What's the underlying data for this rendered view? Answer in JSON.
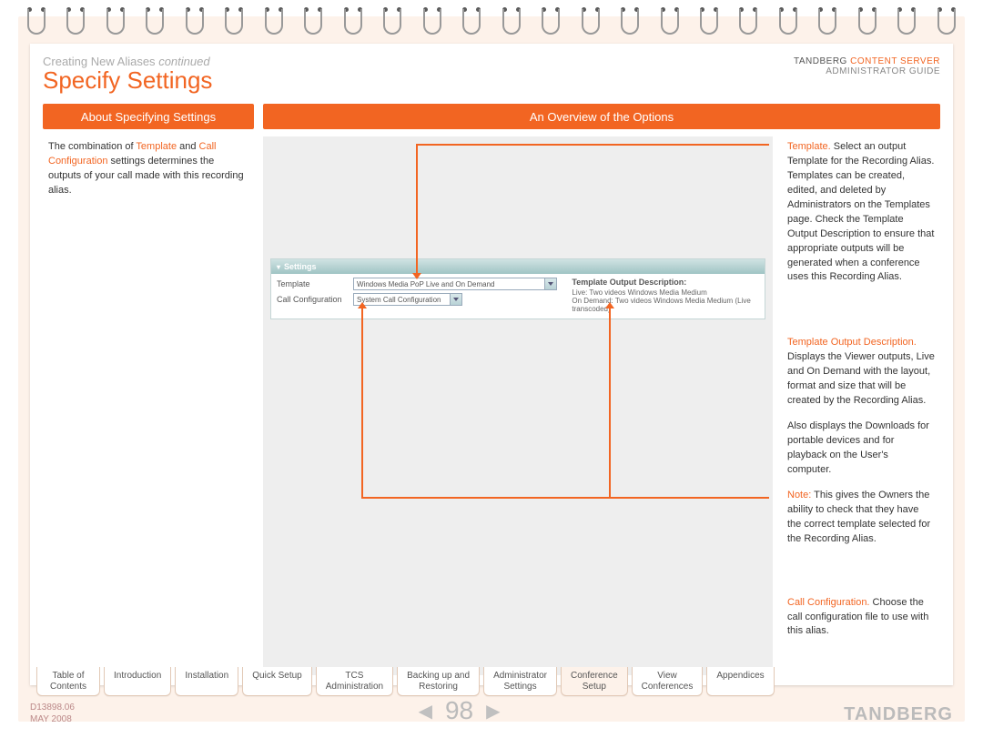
{
  "header": {
    "breadcrumb_main": "Creating New Aliases",
    "breadcrumb_cont": "continued",
    "title": "Specify Settings",
    "brand_line1_a": "TANDBERG",
    "brand_line1_b": "CONTENT SERVER",
    "brand_line2": "ADMINISTRATOR GUIDE"
  },
  "tabs": {
    "left": "About Specifying Settings",
    "right": "An Overview of the Options"
  },
  "left_panel": {
    "p1a": "The combination of ",
    "p1_orange1": "Template",
    "p1b": " and ",
    "p1_orange2": "Call Configuration",
    "p1c": " settings determines the outputs of your call made with this recording alias."
  },
  "settings": {
    "header": "Settings",
    "template_label": "Template",
    "template_value": "Windows Media PoP Live and On Demand",
    "callcfg_label": "Call Configuration",
    "callcfg_value": "System Call Configuration",
    "output_hdr": "Template Output Description:",
    "output_line1": "Live: Two videos Windows Media Medium",
    "output_line2": "On Demand: Two videos Windows Media Medium (Live transcoded)"
  },
  "right_panel": {
    "b1_lead": "Template.",
    "b1_text": " Select an output Template for the Recording Alias. Templates can be created, edited, and deleted by Administrators on the Templates page. Check the Template Output Description to ensure that appropriate outputs will be generated when a conference uses this Recording Alias.",
    "b2_lead": "Template Output Description.",
    "b2_text": " Displays the Viewer outputs, Live and On Demand with the layout, format and size that will be created by the Recording Alias.",
    "b2_text2": "Also displays the Downloads for portable devices and for playback on the User's computer.",
    "b2_note_lead": "Note:",
    "b2_note_text": " This gives the Owners the ability to check that they have the correct template selected for the Recording Alias.",
    "b3_lead": "Call Configuration.",
    "b3_text": " Choose the call configuration file to use with this alias."
  },
  "nav": {
    "items": [
      {
        "l1": "Table of",
        "l2": "Contents"
      },
      {
        "l1": "Introduction",
        "l2": ""
      },
      {
        "l1": "Installation",
        "l2": ""
      },
      {
        "l1": "Quick Setup",
        "l2": ""
      },
      {
        "l1": "TCS",
        "l2": "Administration"
      },
      {
        "l1": "Backing up and",
        "l2": "Restoring"
      },
      {
        "l1": "Administrator",
        "l2": "Settings"
      },
      {
        "l1": "Conference",
        "l2": "Setup"
      },
      {
        "l1": "View",
        "l2": "Conferences"
      },
      {
        "l1": "Appendices",
        "l2": ""
      }
    ],
    "active_index": 7
  },
  "footer": {
    "doc_id": "D13898.06",
    "doc_date": "MAY 2008",
    "page_number": "98",
    "brand": "TANDBERG"
  }
}
